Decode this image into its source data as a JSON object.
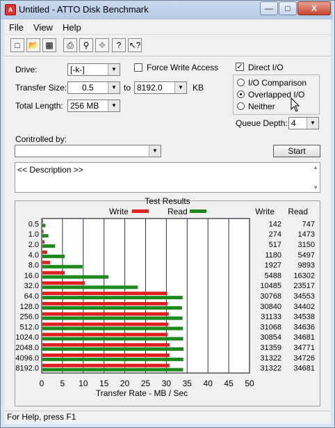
{
  "window": {
    "title": "Untitled - ATTO Disk Benchmark",
    "controls": [
      "—",
      "□",
      "X"
    ]
  },
  "menu": [
    "File",
    "View",
    "Help"
  ],
  "toolbar_icons": [
    "new-icon",
    "open-icon",
    "save-icon",
    "print-icon",
    "print-preview-icon",
    "move-icon",
    "help-icon",
    "context-help-icon"
  ],
  "form": {
    "drive_label": "Drive:",
    "drive_value": "[-k-]",
    "force_write_label": "Force Write Access",
    "direct_io_label": "Direct I/O",
    "transfer_size_label": "Transfer Size:",
    "transfer_from": "0.5",
    "to_label": "to",
    "transfer_to": "8192.0",
    "kb_label": "KB",
    "total_length_label": "Total Length:",
    "total_length_value": "256 MB",
    "io_comparison_label": "I/O Comparison",
    "overlapped_io_label": "Overlapped I/O",
    "neither_label": "Neither",
    "queue_depth_label": "Queue Depth:",
    "queue_depth_value": "4",
    "controlled_by_label": "Controlled by:",
    "start_label": "Start",
    "description_text": "<< Description >>"
  },
  "status": "For Help, press F1",
  "chart_data": {
    "type": "bar",
    "orientation": "horizontal",
    "title": "Test Results",
    "xlabel": "Transfer Rate - MB / Sec",
    "xlim": [
      0,
      50
    ],
    "xticks": [
      "0",
      "5",
      "10",
      "15",
      "20",
      "25",
      "30",
      "35",
      "40",
      "45",
      "50"
    ],
    "categories": [
      "0.5",
      "1.0",
      "2.0",
      "4.0",
      "8.0",
      "16.0",
      "32.0",
      "64.0",
      "128.0",
      "256.0",
      "512.0",
      "1024.0",
      "2048.0",
      "4096.0",
      "8192.0"
    ],
    "series": [
      {
        "name": "Write",
        "color": "#e02020",
        "values": [
          142,
          274,
          517,
          1180,
          1927,
          5488,
          10485,
          30768,
          30840,
          31133,
          31068,
          30854,
          31359,
          31322,
          31322
        ]
      },
      {
        "name": "Read",
        "color": "#1e8a1e",
        "values": [
          747,
          1473,
          3150,
          5497,
          9893,
          16302,
          23517,
          34553,
          34402,
          34538,
          34636,
          34681,
          34771,
          34726,
          34681
        ]
      }
    ],
    "table_headers": [
      "Write",
      "Read"
    ],
    "grid_color": "#1c2a8c"
  }
}
